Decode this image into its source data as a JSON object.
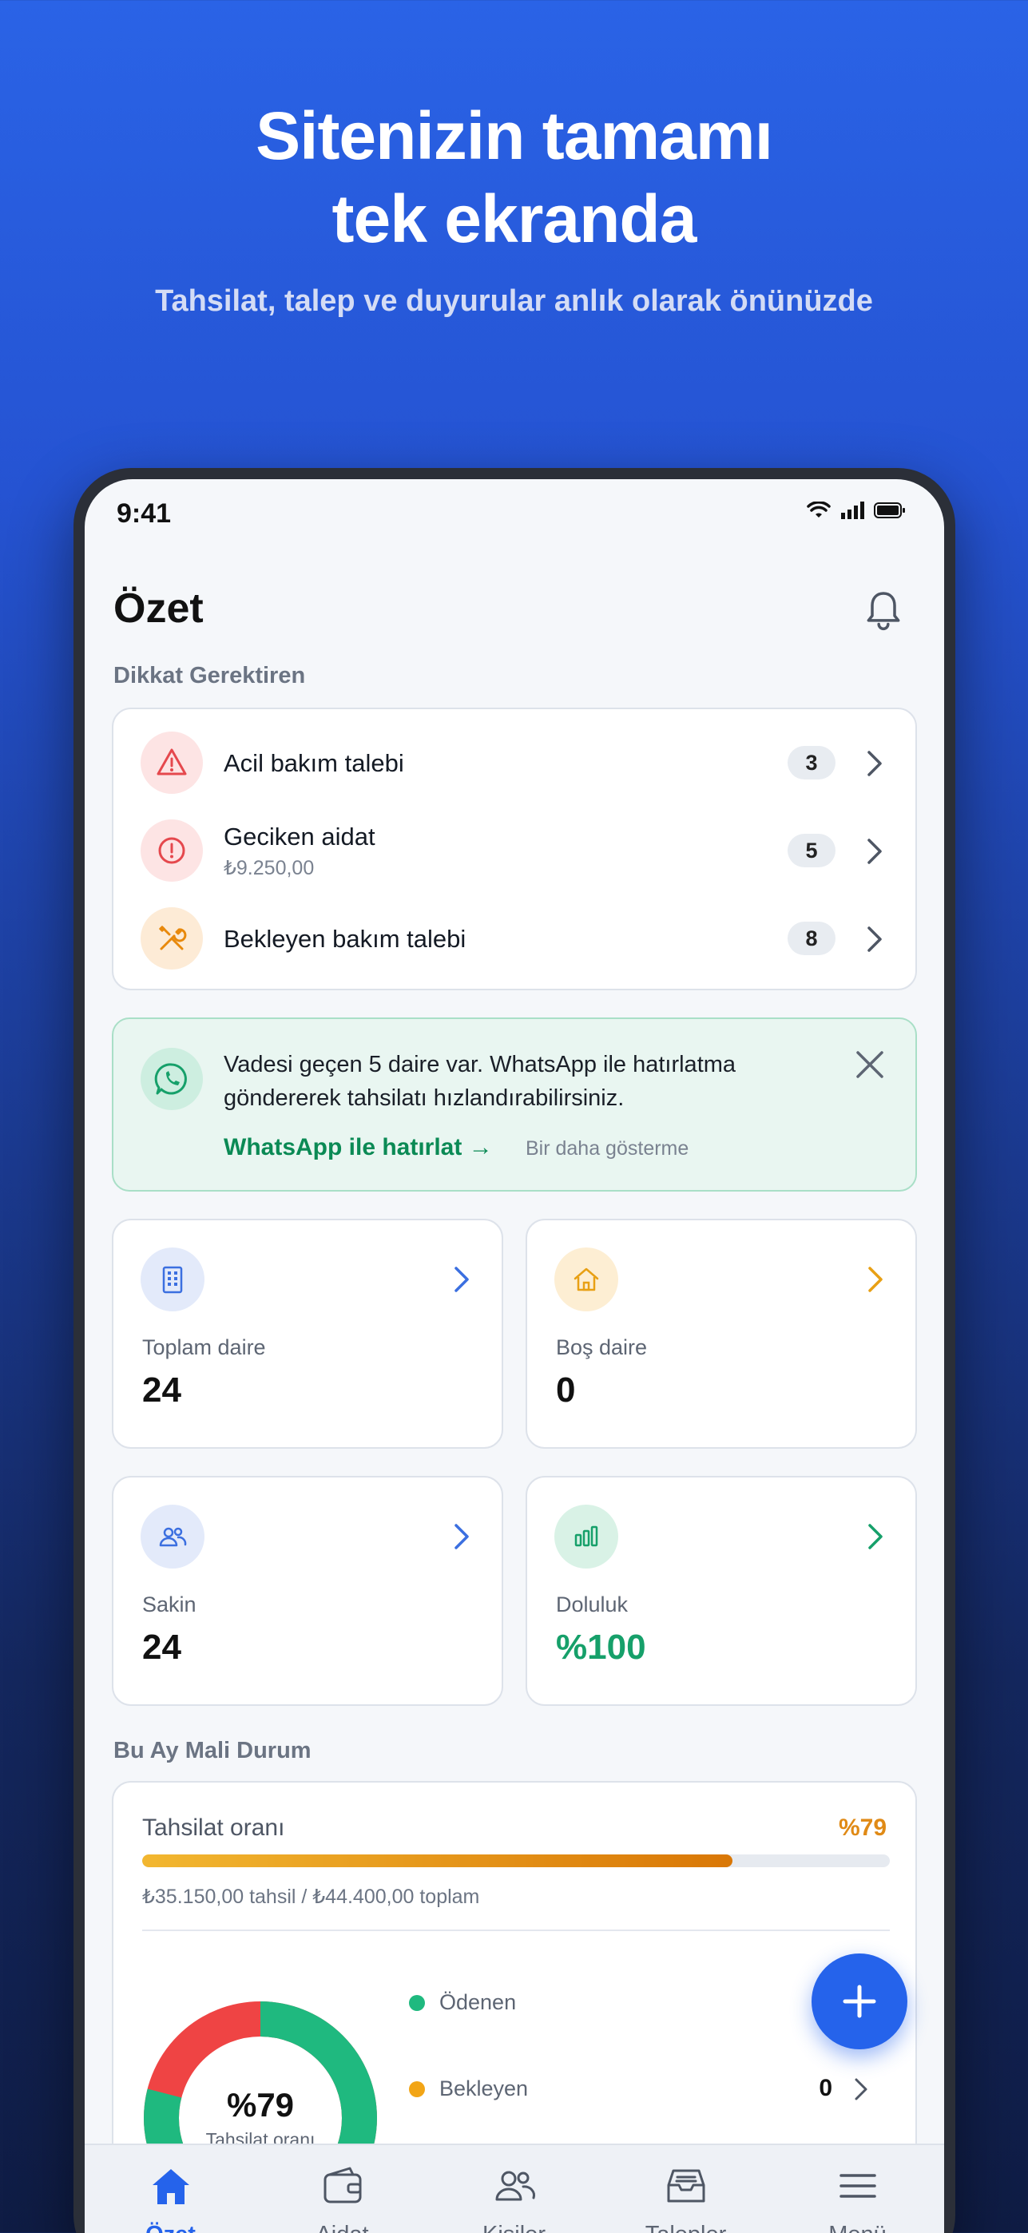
{
  "hero": {
    "title_line1": "Sitenizin tamamı",
    "title_line2": "tek ekranda",
    "subtitle": "Tahsilat, talep ve duyurular anlık olarak önünüzde"
  },
  "status_bar": {
    "time": "9:41"
  },
  "header": {
    "title": "Özet",
    "bell_icon": "bell-icon"
  },
  "attention": {
    "section_label": "Dikkat Gerektiren",
    "items": [
      {
        "title": "Acil bakım talebi",
        "subtitle": "",
        "count": "3",
        "icon": "warning-triangle-icon",
        "color": "#e5484d"
      },
      {
        "title": "Geciken aidat",
        "subtitle": "₺9.250,00",
        "count": "5",
        "icon": "alert-circle-icon",
        "color": "#e5484d"
      },
      {
        "title": "Bekleyen bakım talebi",
        "subtitle": "",
        "count": "8",
        "icon": "tools-icon",
        "color": "#e8890c"
      }
    ]
  },
  "whatsapp_banner": {
    "text": "Vadesi geçen 5 daire var. WhatsApp ile hatırlatma göndererek tahsilatı hızlandırabilirsiniz.",
    "link": "WhatsApp ile hatırlat →",
    "dismiss": "Bir daha gösterme",
    "icon": "whatsapp-icon"
  },
  "stats": [
    {
      "label": "Toplam daire",
      "value": "24",
      "icon": "building-icon",
      "accent": "#3b6fe0"
    },
    {
      "label": "Boş daire",
      "value": "0",
      "icon": "home-icon",
      "accent": "#e8a014"
    },
    {
      "label": "Sakin",
      "value": "24",
      "icon": "people-icon",
      "accent": "#3b6fe0"
    },
    {
      "label": "Doluluk",
      "value": "%100",
      "icon": "bar-chart-icon",
      "accent": "#16a06a"
    }
  ],
  "finance": {
    "section_label": "Bu Ay Mali Durum",
    "collection_label": "Tahsilat oranı",
    "collection_pct": "%79",
    "collection_fraction": 0.79,
    "summary": "₺35.150,00 tahsil / ₺44.400,00 toplam",
    "donut_pct": "%79",
    "donut_label": "Tahsilat oranı",
    "legend": [
      {
        "label": "Ödenen",
        "value": "",
        "color": "#1fb97f"
      },
      {
        "label": "Bekleyen",
        "value": "0",
        "color": "#f2a516"
      }
    ]
  },
  "tabbar": [
    {
      "label": "Özet",
      "icon": "home-icon",
      "active": true
    },
    {
      "label": "Aidat",
      "icon": "wallet-icon",
      "active": false
    },
    {
      "label": "Kişiler",
      "icon": "people-icon",
      "active": false
    },
    {
      "label": "Talepler",
      "icon": "inbox-icon",
      "active": false
    },
    {
      "label": "Menü",
      "icon": "menu-icon",
      "active": false
    }
  ]
}
